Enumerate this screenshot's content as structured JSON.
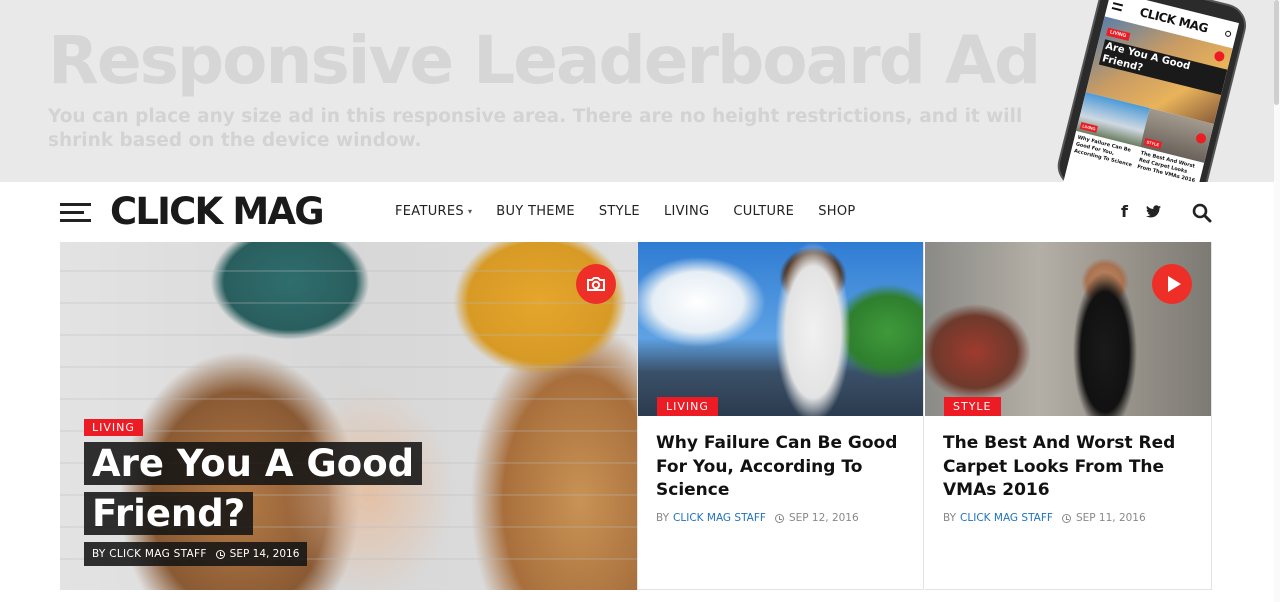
{
  "ad": {
    "title": "Responsive Leaderboard Ad",
    "text": "You can place any size ad in this responsive area. There are no height restrictions, and it will shrink based on the device window."
  },
  "phone_preview": {
    "logo": "CLICK MAG",
    "hero_badge": "LIVING",
    "hero_title": "Are You A Good Friend?",
    "left_badge": "LIVING",
    "right_badge": "STYLE",
    "left_caption": "Why Failure Can Be Good For You, According To Science",
    "right_caption": "The Best And Worst Red Carpet Looks From The VMAs 2016"
  },
  "header": {
    "logo": "CLICK MAG",
    "nav": [
      {
        "label": "FEATURES",
        "has_dropdown": true
      },
      {
        "label": "BUY THEME"
      },
      {
        "label": "STYLE"
      },
      {
        "label": "LIVING"
      },
      {
        "label": "CULTURE"
      },
      {
        "label": "SHOP"
      }
    ],
    "icons": {
      "menu": "hamburger-icon",
      "facebook": "facebook-icon",
      "twitter": "twitter-icon",
      "search": "search-icon"
    }
  },
  "featured": {
    "main": {
      "badge": "LIVING",
      "title": "Are You A Good Friend?",
      "byline": "BY CLICK MAG STAFF",
      "date": "SEP 14, 2016",
      "icon": "camera-icon"
    },
    "cards": [
      {
        "badge": "LIVING",
        "title": "Why Failure Can Be Good For You, According To Science",
        "by": "BY",
        "author": "CLICK MAG STAFF",
        "date": "SEP 12, 2016"
      },
      {
        "badge": "STYLE",
        "title": "The Best And Worst Red Carpet Looks From The VMAs 2016",
        "by": "BY",
        "author": "CLICK MAG STAFF",
        "date": "SEP 11, 2016",
        "icon": "play-icon"
      }
    ]
  },
  "colors": {
    "accent": "#ed1c24",
    "link": "#1e73be",
    "text": "#111111",
    "ad_background": "#e9e9e9"
  }
}
